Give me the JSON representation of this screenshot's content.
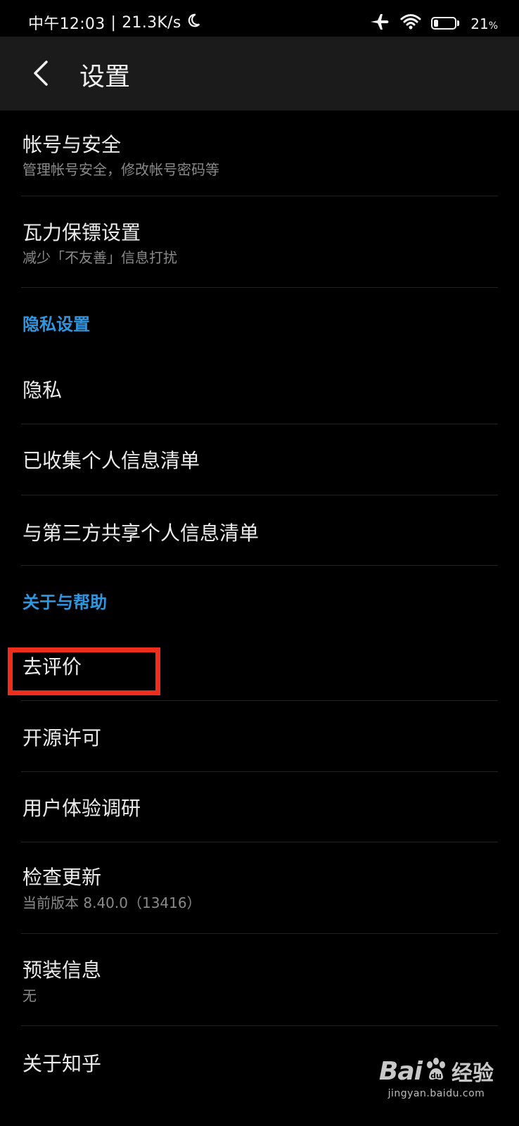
{
  "status_bar": {
    "time": "中午12:03",
    "separator": "|",
    "speed": "21.3K/s",
    "battery_level": 0.21,
    "battery_number": "21",
    "battery_unit": "%"
  },
  "header": {
    "title": "设置"
  },
  "items": {
    "account": {
      "title": "帐号与安全",
      "subtitle": "管理帐号安全，修改帐号密码等"
    },
    "guard": {
      "title": "瓦力保镖设置",
      "subtitle": "减少「不友善」信息打扰"
    },
    "section_privacy": "隐私设置",
    "privacy": {
      "title": "隐私"
    },
    "collected": {
      "title": "已收集个人信息清单"
    },
    "shared": {
      "title": "与第三方共享个人信息清单"
    },
    "section_about": "关于与帮助",
    "rate": {
      "title": "去评价"
    },
    "license": {
      "title": "开源许可"
    },
    "survey": {
      "title": "用户体验调研"
    },
    "update": {
      "title": "检查更新",
      "subtitle": "当前版本 8.40.0（13416）"
    },
    "preinstall": {
      "title": "预装信息",
      "subtitle": "无"
    },
    "about": {
      "title": "关于知乎"
    }
  },
  "watermark": {
    "logo_text_left": "Bai",
    "logo_text_right": "经验",
    "url": "jingyan.baidu.com"
  },
  "colors": {
    "background": "#000000",
    "header_background": "#1b1b1b",
    "section_accent": "#2f96e0",
    "highlight_box": "#ee2d1c"
  }
}
